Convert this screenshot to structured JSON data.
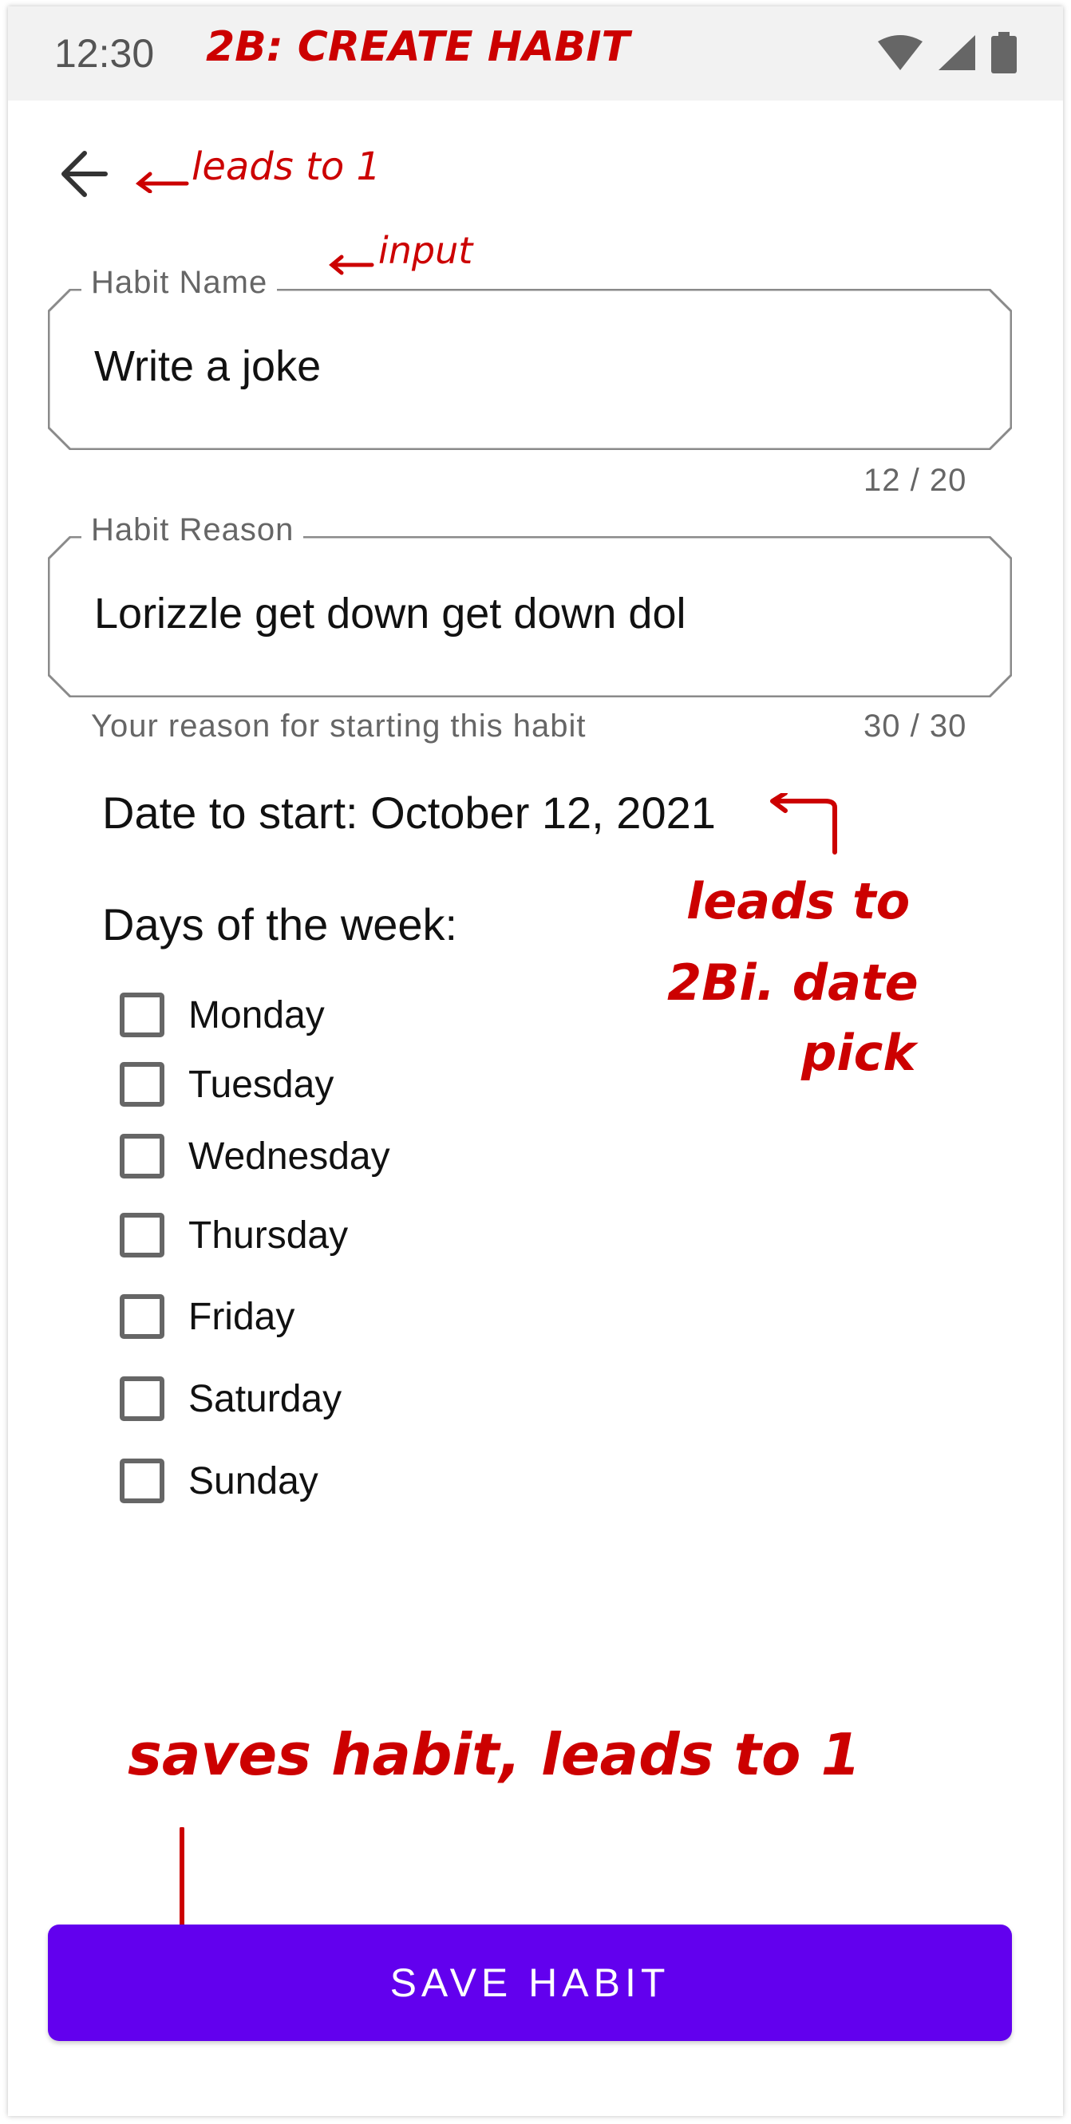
{
  "status_bar": {
    "time": "12:30",
    "icons": [
      "wifi-icon",
      "signal-icon",
      "battery-icon"
    ]
  },
  "annotations": {
    "screen_title": "2B: CREATE HABIT",
    "back": "leads to 1",
    "input": "input",
    "date_line1": "leads to",
    "date_line2": "2Bi. date",
    "date_line3": "pick",
    "save": "saves habit, leads to 1"
  },
  "form": {
    "habit_name": {
      "label": "Habit Name",
      "value": "Write a joke",
      "counter": "12 / 20"
    },
    "habit_reason": {
      "label": "Habit Reason",
      "value": "Lorizzle get down get down dol",
      "helper": "Your reason for starting this habit",
      "counter": "30 / 30"
    },
    "date_to_start": "Date to start: October 12, 2021",
    "days_heading": "Days of the week:",
    "days": [
      {
        "label": "Monday",
        "checked": false
      },
      {
        "label": "Tuesday",
        "checked": false
      },
      {
        "label": "Wednesday",
        "checked": false
      },
      {
        "label": "Thursday",
        "checked": false
      },
      {
        "label": "Friday",
        "checked": false
      },
      {
        "label": "Saturday",
        "checked": false
      },
      {
        "label": "Sunday",
        "checked": false
      }
    ]
  },
  "save_button": "SAVE HABIT",
  "colors": {
    "accent": "#6200ee",
    "annotation": "#cc0000"
  }
}
